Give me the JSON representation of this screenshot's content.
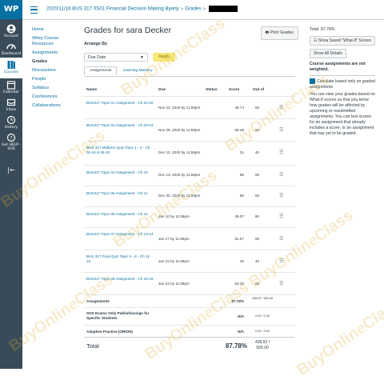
{
  "app": {
    "logo": "WP"
  },
  "global_nav": [
    {
      "label": "Account",
      "icon": "account-icon"
    },
    {
      "label": "Dashboard",
      "icon": "dashboard-icon"
    },
    {
      "label": "Courses",
      "icon": "courses-icon"
    },
    {
      "label": "Calendar",
      "icon": "calendar-icon"
    },
    {
      "label": "Inbox",
      "icon": "inbox-icon"
    },
    {
      "label": "History",
      "icon": "history-icon"
    },
    {
      "label": "Get HELP - SOS",
      "icon": "help-icon"
    }
  ],
  "breadcrumb": {
    "course": "2020/11/16 BUS 317 0S01 Financial Decision Making Byerly",
    "sep": ">",
    "page": "Grades"
  },
  "course_nav": [
    "Home",
    "Wiley Course Resources",
    "Assignments",
    "Grades",
    "Discussions",
    "People",
    "Syllabus",
    "Conferences",
    "Collaborations"
  ],
  "main": {
    "title": "Grades for sara Decker",
    "print_label": "Print Grades",
    "arrange_label": "Arrange By",
    "arrange_value": "Due Date",
    "apply_label": "Apply",
    "tabs": [
      "Assignments",
      "Learning Mastery"
    ],
    "headers": {
      "name": "Name",
      "due": "Due",
      "status": "Status",
      "score": "Score",
      "out_of": "Out of"
    }
  },
  "rows": [
    {
      "name": "BUS317 Topic 01 Assignment - Ch 01-02",
      "due": "Nov 22, 2020 by 11:59pm",
      "score": "49.74",
      "out_of": "60"
    },
    {
      "name": "BUS317 Topic 02 Assignment - Ch 03-04",
      "due": "Nov 29, 2020 by 11:59pm",
      "score": "59.29",
      "out_of": "60"
    },
    {
      "name": "BUS 317 Midterm Quiz Topic 1 - 4 - Ch 01-04 & 09-10",
      "due": "Dec 13, 2020 by 11:59pm",
      "score": "31",
      "out_of": "40"
    },
    {
      "name": "BUS317 Topic 04 Assignment - Ch 10",
      "due": "Dec 13, 2020 by 11:59pm",
      "score": "58",
      "out_of": "60"
    },
    {
      "name": "BUS317 Topic 05 Assignment - Ch 11",
      "due": "Dec 20, 2020 by 11:59pm",
      "score": "55",
      "out_of": "60"
    },
    {
      "name": "BUS317 Topic 06 Assignment - Ch 12",
      "due": "Jan 10 by 11:59pm",
      "score": "49.07",
      "out_of": "60"
    },
    {
      "name": "BUS317 Topic 07 Assignment - Ch 13-14",
      "due": "Jan 17 by 11:59pm",
      "score": "51.57",
      "out_of": "60"
    },
    {
      "name": "BUS 317 Final Quiz Topic 5 - 8 - Ch 11-16",
      "due": "Jan 24 by 11:59pm",
      "score": "32",
      "out_of": "40"
    },
    {
      "name": "BUS317 Topic 08 Assignment - Ch 15-16",
      "due": "Jan 24 by 11:59pm",
      "score": "53.25",
      "out_of": "60"
    }
  ],
  "groups": [
    {
      "name": "Assignments",
      "score": "87.78%",
      "out_of": "438.92 / 500.00"
    },
    {
      "name": "SOS Exams Only Publish/assign for Specific Students",
      "score": "N/A",
      "out_of": "0.00 / 0.00"
    },
    {
      "name": "Adaptive Practice (ORION)",
      "score": "N/A",
      "out_of": "0.00 / 0.00"
    }
  ],
  "total": {
    "label": "Total",
    "score": "87.78%",
    "out_of": "438.92 / 500.00"
  },
  "sidebar": {
    "total": "Total: 87.78%",
    "show_whatif": "Show Saved \"What-If\" Scores",
    "show_details": "Show All Details",
    "weight_note": "Course assignments are not weighted.",
    "calc_label": "Calculate based only on graded assignments",
    "calc_desc": "You can view your grades based on What-If scores so that you know how grades will be affected by upcoming or resubmitted assignments. You can test scores for an assignment that already includes a score, or an assignment that has yet to be graded."
  },
  "watermark": "BuyOnlineClass"
}
